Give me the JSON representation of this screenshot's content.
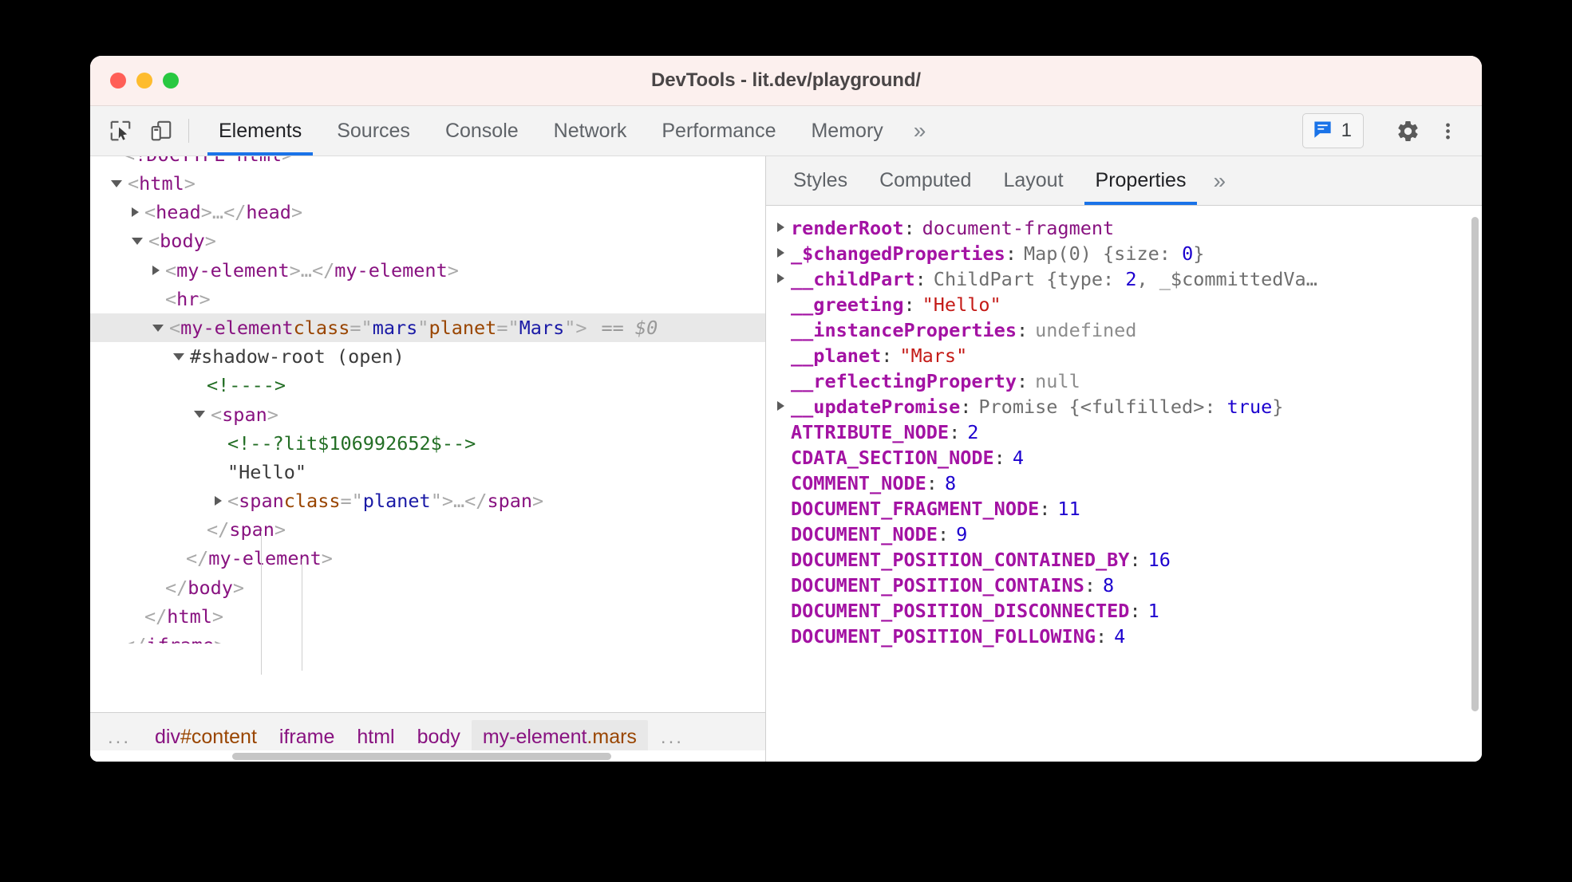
{
  "window": {
    "title": "DevTools - lit.dev/playground/",
    "traffic_lights": [
      "close",
      "minimize",
      "zoom"
    ]
  },
  "toolbar": {
    "inspect_icon": "inspect-cursor-icon",
    "device_icon": "device-toolbar-icon",
    "tabs": [
      {
        "label": "Elements",
        "active": true
      },
      {
        "label": "Sources",
        "active": false
      },
      {
        "label": "Console",
        "active": false
      },
      {
        "label": "Network",
        "active": false
      },
      {
        "label": "Performance",
        "active": false
      },
      {
        "label": "Memory",
        "active": false
      }
    ],
    "more_label": "»",
    "message_badge": {
      "icon": "message-bubble-icon",
      "count": "1"
    },
    "settings_icon": "gear-icon",
    "menu_icon": "vertical-dots-icon"
  },
  "dom_tree": {
    "rows": [
      {
        "indent": 0,
        "twist": "none",
        "parts": [
          {
            "t": "punct",
            "v": "<"
          },
          {
            "t": "tag",
            "v": "!DOCTYPE html"
          },
          {
            "t": "punct",
            "v": ">"
          }
        ],
        "clipped": true
      },
      {
        "indent": 0,
        "twist": "open",
        "parts": [
          {
            "t": "punct",
            "v": "<"
          },
          {
            "t": "tag",
            "v": "html"
          },
          {
            "t": "punct",
            "v": ">"
          }
        ]
      },
      {
        "indent": 1,
        "twist": "closed",
        "parts": [
          {
            "t": "punct",
            "v": "<"
          },
          {
            "t": "tag",
            "v": "head"
          },
          {
            "t": "punct",
            "v": ">"
          },
          {
            "t": "punct",
            "v": "…"
          },
          {
            "t": "punct",
            "v": "</"
          },
          {
            "t": "tag",
            "v": "head"
          },
          {
            "t": "punct",
            "v": ">"
          }
        ]
      },
      {
        "indent": 1,
        "twist": "open",
        "parts": [
          {
            "t": "punct",
            "v": "<"
          },
          {
            "t": "tag",
            "v": "body"
          },
          {
            "t": "punct",
            "v": ">"
          }
        ]
      },
      {
        "indent": 2,
        "twist": "closed",
        "parts": [
          {
            "t": "punct",
            "v": "<"
          },
          {
            "t": "tag",
            "v": "my-element"
          },
          {
            "t": "punct",
            "v": ">"
          },
          {
            "t": "punct",
            "v": "…"
          },
          {
            "t": "punct",
            "v": "</"
          },
          {
            "t": "tag",
            "v": "my-element"
          },
          {
            "t": "punct",
            "v": ">"
          }
        ]
      },
      {
        "indent": 2,
        "twist": "none",
        "parts": [
          {
            "t": "punct",
            "v": "<"
          },
          {
            "t": "tag",
            "v": "hr"
          },
          {
            "t": "punct",
            "v": ">"
          }
        ]
      },
      {
        "indent": 2,
        "twist": "open",
        "selected": true,
        "parts": [
          {
            "t": "punct",
            "v": "<"
          },
          {
            "t": "tag",
            "v": "my-element"
          },
          {
            "t": "sp",
            "v": " "
          },
          {
            "t": "attr",
            "v": "class"
          },
          {
            "t": "punct",
            "v": "=\""
          },
          {
            "t": "aval",
            "v": "mars"
          },
          {
            "t": "punct",
            "v": "\""
          },
          {
            "t": "sp",
            "v": " "
          },
          {
            "t": "attr",
            "v": "planet"
          },
          {
            "t": "punct",
            "v": "=\""
          },
          {
            "t": "aval",
            "v": "Mars"
          },
          {
            "t": "punct",
            "v": "\""
          },
          {
            "t": "punct",
            "v": ">"
          },
          {
            "t": "marker",
            "v": "== $0"
          }
        ]
      },
      {
        "indent": 3,
        "twist": "open",
        "parts": [
          {
            "t": "shadow",
            "v": "#shadow-root (open)"
          }
        ]
      },
      {
        "indent": 4,
        "twist": "none",
        "parts": [
          {
            "t": "comment",
            "v": "<!---->"
          }
        ]
      },
      {
        "indent": 4,
        "twist": "open",
        "parts": [
          {
            "t": "punct",
            "v": "<"
          },
          {
            "t": "tag",
            "v": "span"
          },
          {
            "t": "punct",
            "v": ">"
          }
        ]
      },
      {
        "indent": 5,
        "twist": "none",
        "parts": [
          {
            "t": "comment",
            "v": "<!--?lit$106992652$-->"
          }
        ]
      },
      {
        "indent": 5,
        "twist": "none",
        "parts": [
          {
            "t": "txtnode",
            "v": "\"Hello\""
          }
        ]
      },
      {
        "indent": 5,
        "twist": "closed",
        "parts": [
          {
            "t": "punct",
            "v": "<"
          },
          {
            "t": "tag",
            "v": "span"
          },
          {
            "t": "sp",
            "v": " "
          },
          {
            "t": "attr",
            "v": "class"
          },
          {
            "t": "punct",
            "v": "=\""
          },
          {
            "t": "aval",
            "v": "planet"
          },
          {
            "t": "punct",
            "v": "\""
          },
          {
            "t": "punct",
            "v": ">"
          },
          {
            "t": "punct",
            "v": "…"
          },
          {
            "t": "punct",
            "v": "</"
          },
          {
            "t": "tag",
            "v": "span"
          },
          {
            "t": "punct",
            "v": ">"
          }
        ]
      },
      {
        "indent": 4,
        "twist": "none",
        "parts": [
          {
            "t": "punct",
            "v": "</"
          },
          {
            "t": "tag",
            "v": "span"
          },
          {
            "t": "punct",
            "v": ">"
          }
        ]
      },
      {
        "indent": 3,
        "twist": "none",
        "parts": [
          {
            "t": "punct",
            "v": "</"
          },
          {
            "t": "tag",
            "v": "my-element"
          },
          {
            "t": "punct",
            "v": ">"
          }
        ]
      },
      {
        "indent": 2,
        "twist": "none",
        "parts": [
          {
            "t": "punct",
            "v": "</"
          },
          {
            "t": "tag",
            "v": "body"
          },
          {
            "t": "punct",
            "v": ">"
          }
        ]
      },
      {
        "indent": 1,
        "twist": "none",
        "parts": [
          {
            "t": "punct",
            "v": "</"
          },
          {
            "t": "tag",
            "v": "html"
          },
          {
            "t": "punct",
            "v": ">"
          }
        ]
      },
      {
        "indent": 0,
        "twist": "none",
        "parts": [
          {
            "t": "punct",
            "v": "</"
          },
          {
            "t": "tag",
            "v": "iframe"
          },
          {
            "t": "punct",
            "v": ">"
          }
        ],
        "clipped_bottom": true
      }
    ]
  },
  "breadcrumb": {
    "leading_ellipsis": "...",
    "items": [
      {
        "tag": "div",
        "cls": "#content",
        "selected": false
      },
      {
        "tag": "iframe",
        "cls": "",
        "selected": false
      },
      {
        "tag": "html",
        "cls": "",
        "selected": false
      },
      {
        "tag": "body",
        "cls": "",
        "selected": false
      },
      {
        "tag": "my-element",
        "cls": ".mars",
        "selected": true
      }
    ],
    "trailing_ellipsis": "..."
  },
  "sidebar": {
    "tabs": [
      {
        "label": "Styles",
        "active": false
      },
      {
        "label": "Computed",
        "active": false
      },
      {
        "label": "Layout",
        "active": false
      },
      {
        "label": "Properties",
        "active": true
      }
    ],
    "more_label": "»"
  },
  "properties": {
    "rows": [
      {
        "expandable": true,
        "name": "renderRoot",
        "value": "document-fragment",
        "kind": "obj"
      },
      {
        "expandable": true,
        "name": "_$changedProperties",
        "value": "Map(0) {size: 0}",
        "kind": "mixed",
        "segments": [
          {
            "t": "plain",
            "v": "Map(0) {size: "
          },
          {
            "t": "num",
            "v": "0"
          },
          {
            "t": "plain",
            "v": "}"
          }
        ]
      },
      {
        "expandable": true,
        "name": "__childPart",
        "value": "ChildPart {type: 2, _$committedVa…",
        "kind": "mixed",
        "segments": [
          {
            "t": "plain",
            "v": "ChildPart {type: "
          },
          {
            "t": "num",
            "v": "2"
          },
          {
            "t": "plain",
            "v": ", _$committedVa…"
          }
        ]
      },
      {
        "expandable": false,
        "name": "__greeting",
        "value": "\"Hello\"",
        "kind": "string"
      },
      {
        "expandable": false,
        "name": "__instanceProperties",
        "value": "undefined",
        "kind": "grey"
      },
      {
        "expandable": false,
        "name": "__planet",
        "value": "\"Mars\"",
        "kind": "string"
      },
      {
        "expandable": false,
        "name": "__reflectingProperty",
        "value": "null",
        "kind": "grey"
      },
      {
        "expandable": true,
        "name": "__updatePromise",
        "value": "Promise {<fulfilled>: true}",
        "kind": "mixed",
        "segments": [
          {
            "t": "plain",
            "v": "Promise {<fulfilled>: "
          },
          {
            "t": "bool",
            "v": "true"
          },
          {
            "t": "plain",
            "v": "}"
          }
        ]
      },
      {
        "expandable": false,
        "name": "ATTRIBUTE_NODE",
        "value": "2",
        "kind": "num"
      },
      {
        "expandable": false,
        "name": "CDATA_SECTION_NODE",
        "value": "4",
        "kind": "num"
      },
      {
        "expandable": false,
        "name": "COMMENT_NODE",
        "value": "8",
        "kind": "num"
      },
      {
        "expandable": false,
        "name": "DOCUMENT_FRAGMENT_NODE",
        "value": "11",
        "kind": "num"
      },
      {
        "expandable": false,
        "name": "DOCUMENT_NODE",
        "value": "9",
        "kind": "num"
      },
      {
        "expandable": false,
        "name": "DOCUMENT_POSITION_CONTAINED_BY",
        "value": "16",
        "kind": "num"
      },
      {
        "expandable": false,
        "name": "DOCUMENT_POSITION_CONTAINS",
        "value": "8",
        "kind": "num"
      },
      {
        "expandable": false,
        "name": "DOCUMENT_POSITION_DISCONNECTED",
        "value": "1",
        "kind": "num"
      },
      {
        "expandable": false,
        "name": "DOCUMENT_POSITION_FOLLOWING",
        "value": "4",
        "kind": "num"
      }
    ]
  },
  "colors": {
    "accent": "#1a73e8",
    "tag": "#881280",
    "attr_name": "#994500",
    "attr_value": "#1a1aa6",
    "comment": "#236e25",
    "prop_name": "#a312a3",
    "string": "#c41a16",
    "number": "#1c00cf",
    "titlebar": "#fcf0ee"
  }
}
